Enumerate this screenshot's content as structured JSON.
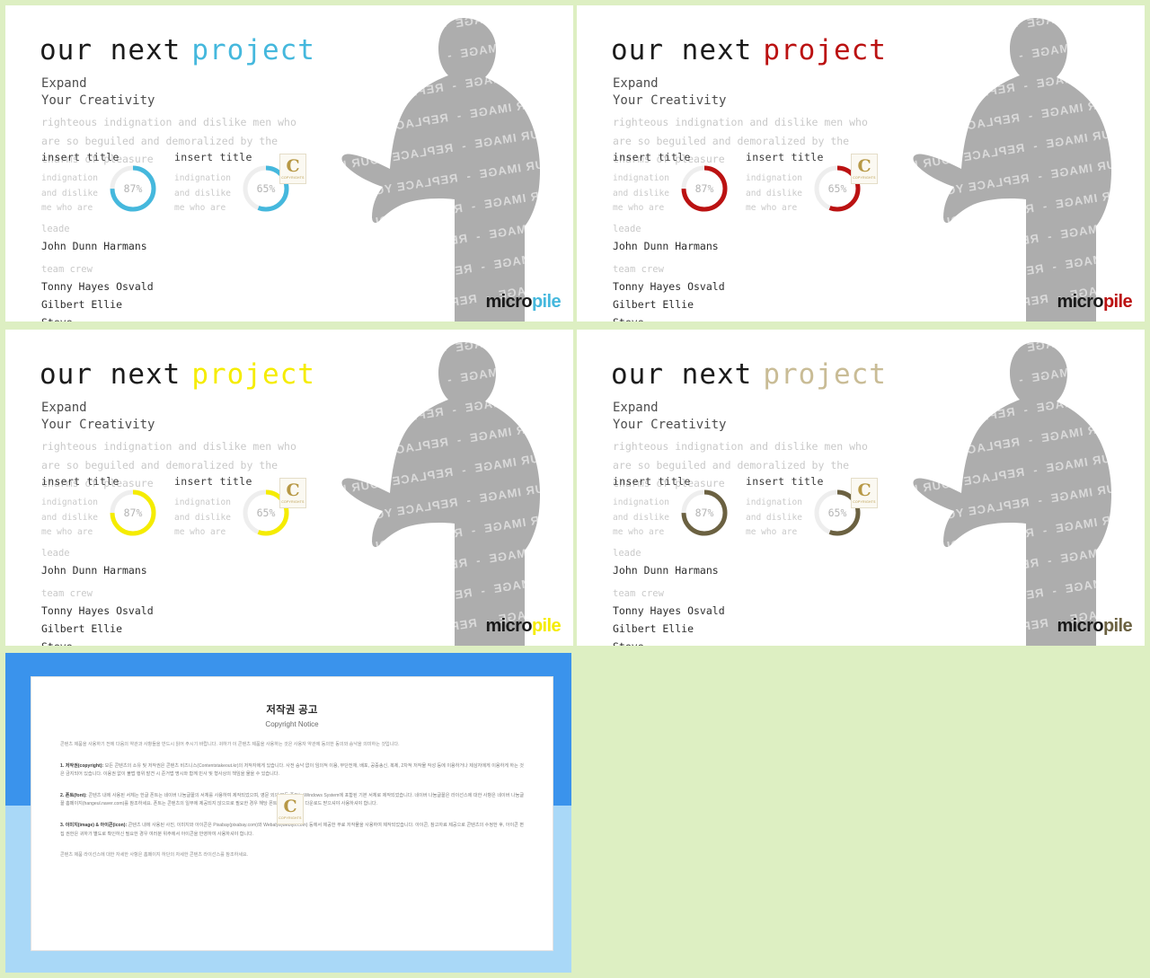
{
  "page": {
    "background_color": "#ddefc2",
    "watermark_text": "REPLACE YOUR IMAGE"
  },
  "slides": [
    {
      "id": "slide-1",
      "accent_color": "#45b8dd",
      "headline_dark": "our next",
      "headline_accent": "project",
      "subtitle": "Expand\nYour Creativity",
      "lede": "righteous indignation and dislike men who\nare so beguiled and demoralized by the\ncharms of pleasure",
      "stats": [
        {
          "title": "insert title",
          "body": "indignation\nand dislike\nme who are",
          "value": "87%",
          "percent": 87
        },
        {
          "title": "insert title",
          "body": "indignation\nand dislike\nme who are",
          "value": "65%",
          "percent": 65
        }
      ],
      "crew": {
        "leader_label": "leade",
        "leader_name": "John Dunn Harmans",
        "team_label": "team crew",
        "members": [
          "Tonny Hayes Osvald",
          "Gilbert Ellie",
          "Steve"
        ]
      },
      "logo_dark": "micro",
      "logo_accent": "pile",
      "badge_glyph": "C",
      "badge_sub": "COPYRIGHTS"
    },
    {
      "id": "slide-2",
      "accent_color": "#bb1212",
      "headline_dark": "our next",
      "headline_accent": "project",
      "subtitle": "Expand\nYour Creativity",
      "lede": "righteous indignation and dislike men who\nare so beguiled and demoralized by the\ncharms of pleasure",
      "stats": [
        {
          "title": "insert title",
          "body": "indignation\nand dislike\nme who are",
          "value": "87%",
          "percent": 87
        },
        {
          "title": "insert title",
          "body": "indignation\nand dislike\nme who are",
          "value": "65%",
          "percent": 65
        }
      ],
      "crew": {
        "leader_label": "leade",
        "leader_name": "John Dunn Harmans",
        "team_label": "team crew",
        "members": [
          "Tonny Hayes Osvald",
          "Gilbert Ellie",
          "Steve"
        ]
      },
      "logo_dark": "micro",
      "logo_accent": "pile",
      "badge_glyph": "C",
      "badge_sub": "COPYRIGHTS"
    },
    {
      "id": "slide-3",
      "accent_color": "#f5ec00",
      "headline_dark": "our next",
      "headline_accent": "project",
      "subtitle": "Expand\nYour Creativity",
      "lede": "righteous indignation and dislike men who\nare so beguiled and demoralized by the\ncharms of pleasure",
      "stats": [
        {
          "title": "insert title",
          "body": "indignation\nand dislike\nme who are",
          "value": "87%",
          "percent": 87
        },
        {
          "title": "insert title",
          "body": "indignation\nand dislike\nme who are",
          "value": "65%",
          "percent": 65
        }
      ],
      "crew": {
        "leader_label": "leade",
        "leader_name": "John Dunn Harmans",
        "team_label": "team crew",
        "members": [
          "Tonny Hayes Osvald",
          "Gilbert Ellie",
          "Steve"
        ]
      },
      "logo_dark": "micro",
      "logo_accent": "pile",
      "badge_glyph": "C",
      "badge_sub": "COPYRIGHTS"
    },
    {
      "id": "slide-4",
      "accent_color": "#6b6141",
      "headline_accent_color": "#c9bc96",
      "headline_dark": "our next",
      "headline_accent": "project",
      "subtitle": "Expand\nYour Creativity",
      "lede": "righteous indignation and dislike men who\nare so beguiled and demoralized by the\ncharms of pleasure",
      "stats": [
        {
          "title": "insert title",
          "body": "indignation\nand dislike\nme who are",
          "value": "87%",
          "percent": 87
        },
        {
          "title": "insert title",
          "body": "indignation\nand dislike\nme who are",
          "value": "65%",
          "percent": 65
        }
      ],
      "crew": {
        "leader_label": "leade",
        "leader_name": "John Dunn Harmans",
        "team_label": "team crew",
        "members": [
          "Tonny Hayes Osvald",
          "Gilbert Ellie",
          "Steve"
        ]
      },
      "logo_dark": "micro",
      "logo_accent": "pile",
      "badge_glyph": "C",
      "badge_sub": "COPYRIGHTS"
    }
  ],
  "notice": {
    "frame_top_color": "#3a93ec",
    "frame_bottom_color": "#a9d8f7",
    "title_ko": "저작권 공고",
    "title_en": "Copyright Notice",
    "intro": "콘텐츠 제품을 사용하기 전에 다음의 약관과 사항들을 반드시 읽어 주시기 바랍니다. 귀하가 이 콘텐츠 제품을 사용하는 것은 사용자 약관에 동의한 동의와 승낙을 의미하는 것입니다.",
    "items": [
      {
        "heading": "1. 저작권(copyright):",
        "text": " 모든 콘텐츠의 소유 및 저작권은 콘텐츠 비즈니스(Contentstakeout.kr)의 저작자에게 있습니다. 사전 승낙 없이 임의적 이용, 무단전재, 배포, 공중송신, 복제, 2차적 저작물 작성 등에 이용하거나 제삼자에게 이용하게 하는 것은 금지되어 있습니다. 이용권 없이 불법 행위 발견 시 준거법 명시와 함께 민사 및 형사상의 책임을 물을 수 있습니다.",
        "badge_here": false
      },
      {
        "heading": "2. 폰트(font):",
        "text": " 콘텐츠 내에 사용된 서체는 한글 폰트는 네이버 나눔글꼴의 서체를 사용하여 제작되었으며, 영문 외의 모든 폰트는 Windows System에 포함된 기본 서체로 제작되었습니다. 네이버 나눔글꼴은 라이선스에 대한 사항은 네이버 나눔글꼴 홈페이지(hangeul.naver.com)를 참조하세요. 폰트는 콘텐츠의 일부에 제공되지 않으므로 필요한 경우 해당 폰트를 개별적으로 다운로드 받으셔야 사용하셔야 합니다.",
        "badge_here": true
      },
      {
        "heading": "3. 이미지(image) & 아이콘(icon):",
        "text": " 콘텐츠 내에 사용된 사진, 이미지와 아이콘은 Pixabay(pixabay.com)와 Webalys(weblys.com) 등에서 제공한 무료 저작물을 사용하여 제작되었습니다. 아이콘, 참고자료 제공으로 콘텐츠의 수정한 후, 아이콘 편집 권한은 귀하가 별도로 확인하신 필요한 경우 여러분 위주에서 아이콘을 반영하여 사용하셔야 합니다.",
        "badge_here": false
      }
    ],
    "outro": "콘텐츠 제품 라이선스에 대한 자세한 사항은 홈페이지 하단의 자세한 콘텐츠 라이선스를 참조하세요.",
    "badge_glyph": "C",
    "badge_sub": "COPYRIGHTS"
  }
}
